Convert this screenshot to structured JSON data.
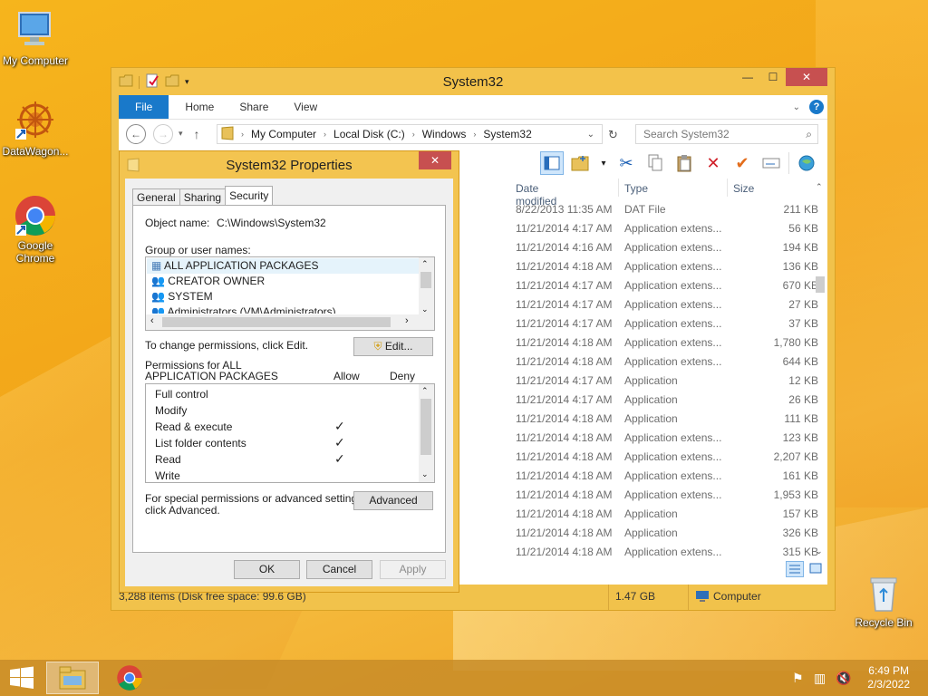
{
  "desktop": {
    "icons": [
      {
        "label": "My Computer"
      },
      {
        "label": "DataWagon..."
      },
      {
        "label": "Google Chrome"
      },
      {
        "label": "Recycle Bin"
      }
    ]
  },
  "explorer": {
    "title": "System32",
    "tabs": [
      "File",
      "Home",
      "Share",
      "View"
    ],
    "breadcrumb": [
      "My Computer",
      "Local Disk (C:)",
      "Windows",
      "System32"
    ],
    "search_placeholder": "Search System32",
    "columns": [
      "Date modified",
      "Type",
      "Size"
    ],
    "rows": [
      {
        "date": "8/22/2013 11:35 AM",
        "type": "DAT File",
        "size": "211 KB"
      },
      {
        "date": "11/21/2014 4:17 AM",
        "type": "Application extens...",
        "size": "56 KB"
      },
      {
        "date": "11/21/2014 4:16 AM",
        "type": "Application extens...",
        "size": "194 KB"
      },
      {
        "date": "11/21/2014 4:18 AM",
        "type": "Application extens...",
        "size": "136 KB"
      },
      {
        "date": "11/21/2014 4:17 AM",
        "type": "Application extens...",
        "size": "670 KB"
      },
      {
        "date": "11/21/2014 4:17 AM",
        "type": "Application extens...",
        "size": "27 KB"
      },
      {
        "date": "11/21/2014 4:17 AM",
        "type": "Application extens...",
        "size": "37 KB"
      },
      {
        "date": "11/21/2014 4:18 AM",
        "type": "Application extens...",
        "size": "1,780 KB"
      },
      {
        "date": "11/21/2014 4:18 AM",
        "type": "Application extens...",
        "size": "644 KB"
      },
      {
        "date": "11/21/2014 4:17 AM",
        "type": "Application",
        "size": "12 KB"
      },
      {
        "date": "11/21/2014 4:17 AM",
        "type": "Application",
        "size": "26 KB"
      },
      {
        "date": "11/21/2014 4:18 AM",
        "type": "Application",
        "size": "111 KB"
      },
      {
        "date": "11/21/2014 4:18 AM",
        "type": "Application extens...",
        "size": "123 KB"
      },
      {
        "date": "11/21/2014 4:18 AM",
        "type": "Application extens...",
        "size": "2,207 KB"
      },
      {
        "date": "11/21/2014 4:18 AM",
        "type": "Application extens...",
        "size": "161 KB"
      },
      {
        "date": "11/21/2014 4:18 AM",
        "type": "Application extens...",
        "size": "1,953 KB"
      },
      {
        "date": "11/21/2014 4:18 AM",
        "type": "Application",
        "size": "157 KB"
      },
      {
        "date": "11/21/2014 4:18 AM",
        "type": "Application",
        "size": "326 KB"
      },
      {
        "date": "11/21/2014 4:18 AM",
        "type": "Application extens...",
        "size": "315 KB"
      }
    ],
    "status": {
      "items": "3,288 items (Disk free space: 99.6 GB)",
      "size": "1.47 GB",
      "location": "Computer"
    }
  },
  "dialog": {
    "title": "System32 Properties",
    "tabs": [
      "General",
      "Sharing",
      "Security"
    ],
    "object_name_label": "Object name:",
    "object_name": "C:\\Windows\\System32",
    "group_label": "Group or user names:",
    "groups": [
      "ALL APPLICATION PACKAGES",
      "CREATOR OWNER",
      "SYSTEM",
      "Administrators (VM\\Administrators)"
    ],
    "change_text": "To change permissions, click Edit.",
    "edit_label": "Edit...",
    "perm_label_1": "Permissions for ALL",
    "perm_label_2": "APPLICATION PACKAGES",
    "allow_label": "Allow",
    "deny_label": "Deny",
    "permissions": [
      {
        "name": "Full control",
        "allow": false
      },
      {
        "name": "Modify",
        "allow": false
      },
      {
        "name": "Read & execute",
        "allow": true
      },
      {
        "name": "List folder contents",
        "allow": true
      },
      {
        "name": "Read",
        "allow": true
      },
      {
        "name": "Write",
        "allow": false
      }
    ],
    "special_text_1": "For special permissions or advanced settings,",
    "special_text_2": "click Advanced.",
    "advanced_label": "Advanced",
    "ok_label": "OK",
    "cancel_label": "Cancel",
    "apply_label": "Apply"
  },
  "taskbar": {
    "time": "6:49 PM",
    "date": "2/3/2022"
  }
}
